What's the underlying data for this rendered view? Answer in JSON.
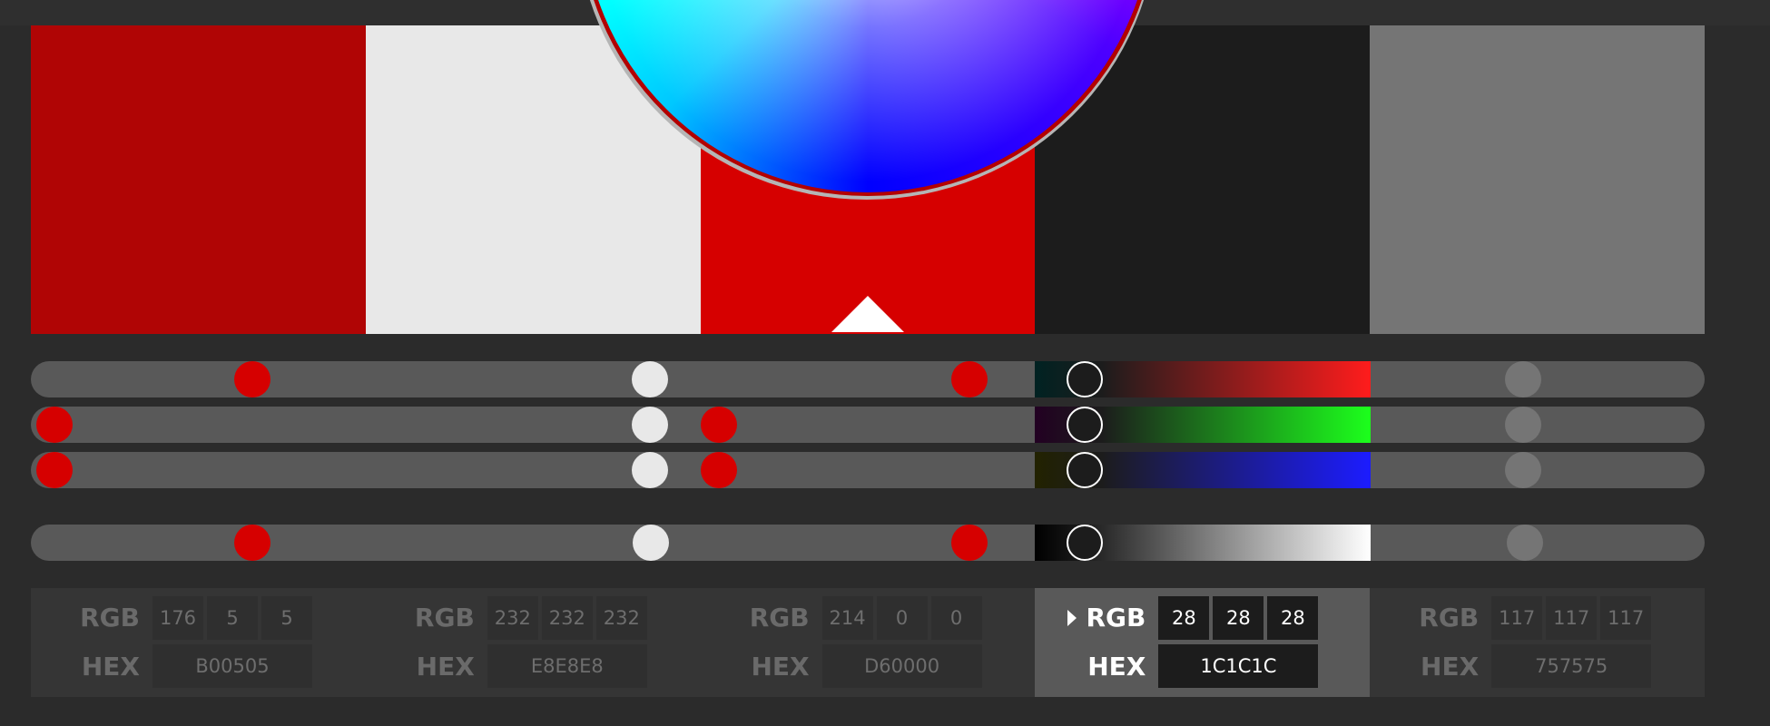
{
  "colors": {
    "background": "#2b2b2b",
    "track": "#595959",
    "panel": "#353535",
    "panel_active": "#595959"
  },
  "swatches": [
    {
      "hex_color": "#B00505"
    },
    {
      "hex_color": "#E8E8E8"
    },
    {
      "hex_color": "#D60000"
    },
    {
      "hex_color": "#1C1C1C"
    },
    {
      "hex_color": "#757575"
    }
  ],
  "panels": [
    {
      "rgb_label": "RGB",
      "hex_label": "HEX",
      "r": "176",
      "g": "5",
      "b": "5",
      "hex": "B00505"
    },
    {
      "rgb_label": "RGB",
      "hex_label": "HEX",
      "r": "232",
      "g": "232",
      "b": "232",
      "hex": "E8E8E8"
    },
    {
      "rgb_label": "RGB",
      "hex_label": "HEX",
      "r": "214",
      "g": "0",
      "b": "0",
      "hex": "D60000"
    },
    {
      "rgb_label": "RGB",
      "hex_label": "HEX",
      "r": "28",
      "g": "28",
      "b": "28",
      "hex": "1C1C1C"
    },
    {
      "rgb_label": "RGB",
      "hex_label": "HEX",
      "r": "117",
      "g": "117",
      "b": "117",
      "hex": "757575"
    }
  ],
  "active_index": 3,
  "icons": {
    "selected_swatch": "triangle-up-icon",
    "active_panel": "caret-right-icon",
    "picker": "color-wheel"
  }
}
